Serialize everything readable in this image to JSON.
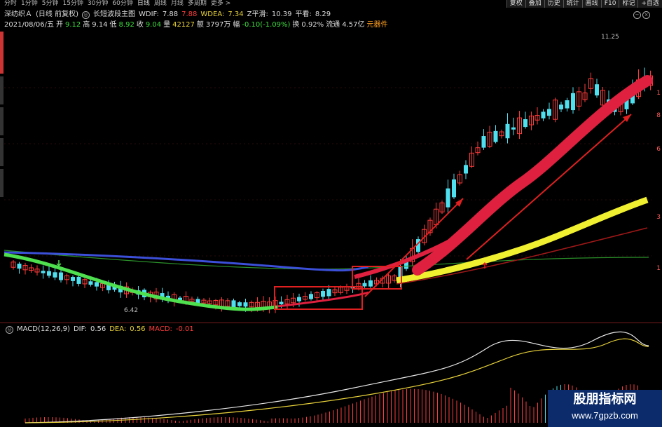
{
  "toolbar": {
    "periods": [
      "分时",
      "1分钟",
      "5分钟",
      "15分钟",
      "30分钟",
      "60分钟",
      "日线",
      "周线",
      "月线",
      "多周期",
      "更多 >"
    ],
    "active_period": "日线",
    "buttons": [
      "复权",
      "叠加",
      "历史",
      "统计",
      "画线",
      "F10",
      "标记",
      "+自选"
    ]
  },
  "info_line1": {
    "stock": "深纺织Ａ",
    "mode": "(日线 前复权)",
    "indicator_name": "长短波段主图",
    "wdif_label": "WDIF:",
    "wdif_value": "7.88",
    "wdif_value2": "7.88",
    "wdea_label": "WDEA:",
    "wdea_value": "7.34",
    "z_label": "Z平滑:",
    "z_value": "10.39",
    "avg_label": "平看:",
    "avg_value": "8.29"
  },
  "info_line2": {
    "date": "2021/08/06/五",
    "open_label": "开",
    "open": "9.12",
    "high_label": "高",
    "high": "9.14",
    "low_label": "低",
    "low": "8.92",
    "close_label": "收",
    "close": "9.04",
    "vol_label": "量",
    "vol": "42127",
    "amt_label": "额",
    "amt": "3797万",
    "chg_label": "幅",
    "chg": "-0.10(-1.09%)",
    "turn_label": "换",
    "turn": "0.92%",
    "float_label": "流通",
    "float": "4.57亿",
    "sector": "元器件"
  },
  "chart": {
    "high_mark": "11.25",
    "low_mark": "6.42",
    "right_axis": [
      "1",
      "8",
      "6",
      "3",
      "1"
    ]
  },
  "macd": {
    "title": "MACD(12,26,9)",
    "dif_label": "DIF:",
    "dif": "0.56",
    "dea_label": "DEA:",
    "dea": "0.56",
    "macd_label": "MACD:",
    "macd": "-0.01"
  },
  "watermark": {
    "title": "股朋指标网",
    "url": "www.7gpzb.com"
  },
  "colors": {
    "up": "#ff3b3b",
    "down": "#4fe0f0",
    "ma_green": "#4ee04e",
    "ma_blue": "#3b4fd8",
    "ma_yellow": "#f0f030",
    "band_red": "#e0203f",
    "annotation_red": "#e02020"
  }
}
